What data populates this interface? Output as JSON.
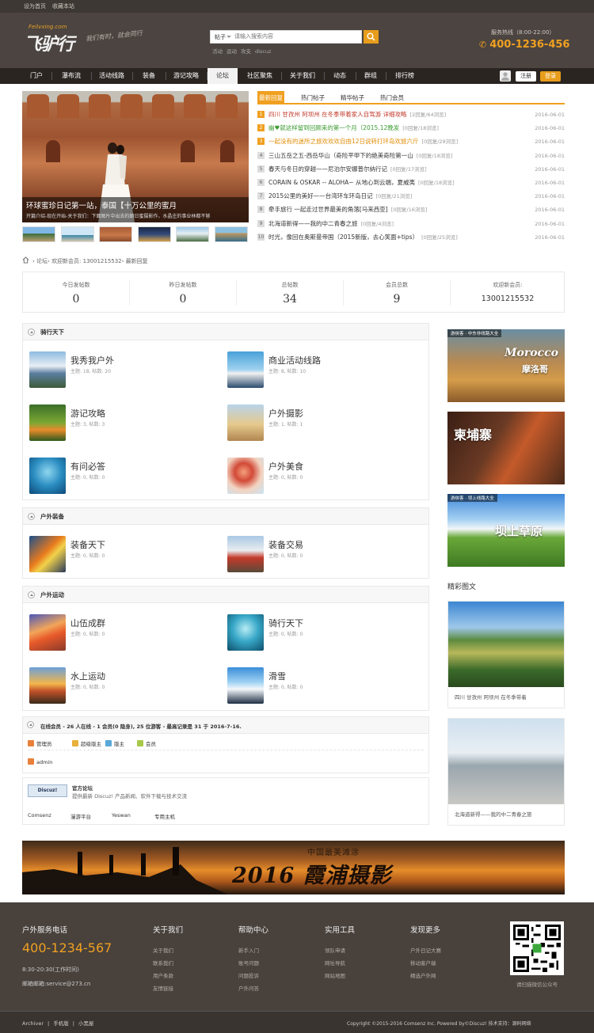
{
  "topbar": {
    "links": [
      "设为首页",
      "收藏本站"
    ]
  },
  "header": {
    "logo_domain": "Feilvxing.com",
    "logo_name": "飞驴行",
    "slogan": "我们有时，就会同行",
    "search": {
      "type": "帖子",
      "placeholder": "请输入搜索内容"
    },
    "hotwords": [
      "活动",
      "运动",
      "攻支",
      "discuz"
    ],
    "hotline_label": "服务热线（8:00-22:00）",
    "hotline": "400-1236-456"
  },
  "nav": {
    "items": [
      "门户",
      "瀑布流",
      "活动线路",
      "装备",
      "游记攻略",
      "论坛",
      "社区聚焦",
      "关于我们",
      "动态",
      "群组",
      "排行榜"
    ],
    "active": 5,
    "register": "注册",
    "login": "登录"
  },
  "slider": {
    "title": "环球蜜珍日记第一站，泰国【十万公里的蜜月",
    "desc": "开篇介绍-现在开始-关于我们：下面图片中出去的朝日蜜摄影作，水晶庄的事业林都不够"
  },
  "tabs": [
    "最新回复",
    "热门帖子",
    "精华帖子",
    "热门会员"
  ],
  "posts": [
    {
      "n": "1",
      "title": "四川 甘孜州 阿坝州 在冬季带着家人自驾游 详细攻略",
      "count": "[2回复/64浏览]",
      "date": "2016-06-01",
      "color": "#c0392b"
    },
    {
      "n": "2",
      "title": "幽♥就这样留到回顾来的第一个月（2015.12晚发",
      "count": "[0回复/18浏览]",
      "date": "2016-06-01",
      "color": "#3a9b2f"
    },
    {
      "n": "3",
      "title": "一起没有的迷所之旅欢欢欢自由12日说转打环岛欢旅六斤",
      "count": "[0回复/29浏览]",
      "date": "2016-06-01",
      "color": "#e08a00"
    },
    {
      "n": "4",
      "title": "三山五岳之五-西岳华山（奇险平甲下的绝美奇险第一山",
      "count": "[0回复/18浏览]",
      "date": "2016-06-01",
      "color": "#333"
    },
    {
      "n": "5",
      "title": "春天与冬日的穿越——尼泊尔安娜普尔纳行记",
      "count": "[0回复/17浏览]",
      "date": "2016-06-01",
      "color": "#333"
    },
    {
      "n": "6",
      "title": "CORAIN & OSKAR -- ALOHA~ 从地心到云端，夏威夷",
      "count": "[0回复/18浏览]",
      "date": "2016-06-01",
      "color": "#333"
    },
    {
      "n": "7",
      "title": "2015公里的美好——台湾环车环岛日记",
      "count": "[0回复/21浏览]",
      "date": "2016-06-01",
      "color": "#333"
    },
    {
      "n": "8",
      "title": "牵手旅行 一起走过世界最美的角落[马来西亚]",
      "count": "[0回复/16浏览]",
      "date": "2016-06-01",
      "color": "#333"
    },
    {
      "n": "9",
      "title": "北海道新得——我的中二青春之旅",
      "count": "[0回复/4浏览]",
      "date": "2016-06-01",
      "color": "#333"
    },
    {
      "n": "10",
      "title": "时光，像回在奥斯曼帝国（2015新版，去心笑面+tips）",
      "count": "[0回复/25浏览]",
      "date": "2016-06-01",
      "color": "#333"
    }
  ],
  "breadcrumb": {
    "a": "论坛",
    "b": "欢迎新会员: 13001215532",
    "c": "最新回复"
  },
  "stats": [
    {
      "label": "今日发帖数",
      "value": "0"
    },
    {
      "label": "昨日发帖数",
      "value": "0"
    },
    {
      "label": "总帖数",
      "value": "34"
    },
    {
      "label": "会员总数",
      "value": "9"
    },
    {
      "label": "欢迎新会员:",
      "value": "13001215532"
    }
  ],
  "sections": [
    {
      "title": "骑行天下",
      "forums": [
        {
          "name": "我秀我户外",
          "stat": "主题: 18, 帖数: 20"
        },
        {
          "name": "商业活动线路",
          "stat": "主题: 8, 帖数: 10"
        },
        {
          "name": "游记攻略",
          "stat": "主题: 3, 帖数: 3"
        },
        {
          "name": "户外摄影",
          "stat": "主题: 1, 帖数: 1"
        },
        {
          "name": "有问必答",
          "stat": "主题: 0, 帖数: 0"
        },
        {
          "name": "户外美食",
          "stat": "主题: 0, 帖数: 0"
        }
      ]
    },
    {
      "title": "户外装备",
      "forums": [
        {
          "name": "装备天下",
          "stat": "主题: 0, 帖数: 0"
        },
        {
          "name": "装备交易",
          "stat": "主题: 0, 帖数: 0"
        }
      ]
    },
    {
      "title": "户外运动",
      "forums": [
        {
          "name": "山伍成群",
          "stat": "主题: 0, 帖数: 0"
        },
        {
          "name": "骑行天下",
          "stat": "主题: 0, 帖数: 0"
        },
        {
          "name": "水上运动",
          "stat": "主题: 0, 帖数: 0"
        },
        {
          "name": "滑雪",
          "stat": "主题: 0, 帖数: 0"
        }
      ]
    }
  ],
  "online": {
    "title": "在线会员 - 26 人在线 - 1 会员(0 隐身), 25 位游客 - 最高记录是 31 于 2016-7-16.",
    "legend": [
      "管理员",
      "超级版主",
      "版主",
      "会员"
    ],
    "users": [
      "admin"
    ]
  },
  "links": {
    "logo": "Discuz!",
    "name": "官方论坛",
    "desc": "提供最新 Discuz! 产品新闻、软件下载与技术交流",
    "items": [
      "Comsenz",
      "漫游平台",
      "Yeswan",
      "专用主机"
    ]
  },
  "ads": [
    {
      "tag": "游侠客 · 中东非线路大全",
      "title": "Morocco",
      "sub": "摩洛哥"
    },
    {
      "tag": "",
      "title": "柬埔寨",
      "sub": ""
    },
    {
      "tag": "游侠客 · 坝上线路大全",
      "title": "坝上草原",
      "sub": ""
    }
  ],
  "sidebar": {
    "title": "精彩图文",
    "pics": [
      "四川 甘孜州 阿坝州 在冬季带着",
      "北海道新得——我的中二青春之旅"
    ]
  },
  "banner": {
    "sub": "中国最美滩涂",
    "title": "2016 霞浦摄影"
  },
  "footer": {
    "tel_label": "户外服务电话",
    "tel": "400-1234-567",
    "hours": "8:30-20:30(工作时间)",
    "mail": "邮箱邮箱:service@273.cn",
    "cols": [
      {
        "h": "关于我们",
        "items": [
          "关于我们",
          "联系我们",
          "用户条款",
          "友情链接"
        ]
      },
      {
        "h": "帮助中心",
        "items": [
          "新手入门",
          "账号问题",
          "问题投诉",
          "户外问答"
        ]
      },
      {
        "h": "实用工具",
        "items": [
          "领队申请",
          "网址导航",
          "网站地图"
        ]
      },
      {
        "h": "发现更多",
        "items": [
          "户外日记大赛",
          "移动客户端",
          "精选户外网"
        ]
      }
    ],
    "qr_caption": "请扫描微信公众号"
  },
  "bottombar": {
    "links": [
      "Archiver",
      "手机版",
      "小黑屋"
    ],
    "copyright": "Copyright  ©2015-2016  Comsenz Inc.  Powered by©Discuz!  技术支持：源码网络"
  }
}
